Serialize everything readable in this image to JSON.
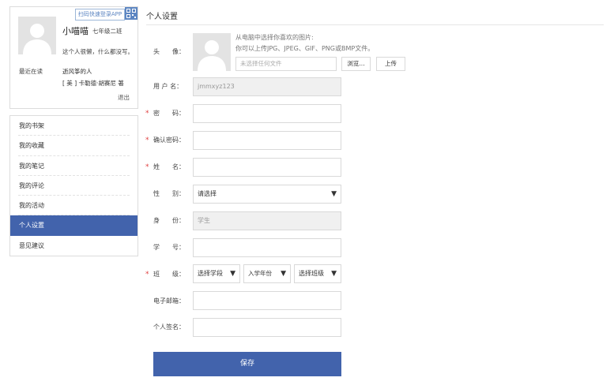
{
  "profile": {
    "app_badge": "扫码快速登录APP",
    "name": "小喵喵",
    "grade": "七年级二班",
    "bio": "这个人很懒，什么都没写。",
    "reading_label": "最近在读",
    "reading_title": "逝风筝的人",
    "reading_author": "[ 美 ] 卡勒德·胡赛尼  著",
    "logout": "退出"
  },
  "menu": {
    "items": [
      {
        "label": "我的书架"
      },
      {
        "label": "我的收藏"
      },
      {
        "label": "我的笔记"
      },
      {
        "label": "我的评论"
      },
      {
        "label": "我的活动"
      },
      {
        "label": "个人设置"
      },
      {
        "label": "意见建议"
      }
    ],
    "active_index": 5
  },
  "settings": {
    "title": "个人设置",
    "avatar": {
      "label": "头　　像：",
      "hint_line1": "从电脑中选择你喜欢的图片:",
      "hint_line2": "你可以上传JPG、JPEG、GIF、PNG或BMP文件。",
      "file_placeholder": "未选择任何文件",
      "browse_label": "浏览...",
      "upload_label": "上传"
    },
    "username": {
      "label": "用 户 名：",
      "value": "jmmxyz123"
    },
    "password": {
      "label": "密　　码：",
      "value": ""
    },
    "confirm_password": {
      "label": "确认密码：",
      "value": ""
    },
    "real_name": {
      "label": "姓　　名：",
      "value": ""
    },
    "gender": {
      "label": "性　　别：",
      "selected": "请选择"
    },
    "identity": {
      "label": "身　　份：",
      "value": "学生"
    },
    "student_id": {
      "label": "学　　号：",
      "value": ""
    },
    "class": {
      "label": "班　　级：",
      "stage": "选择学段",
      "year": "入学年份",
      "class_name": "选择班级"
    },
    "email": {
      "label": "电子邮箱：",
      "value": ""
    },
    "signature": {
      "label": "个人签名：",
      "value": ""
    },
    "required_mark": "*",
    "dropdown_arrow": "▼",
    "save_label": "保存"
  },
  "colors": {
    "accent": "#4263ac",
    "required": "#e04040"
  }
}
